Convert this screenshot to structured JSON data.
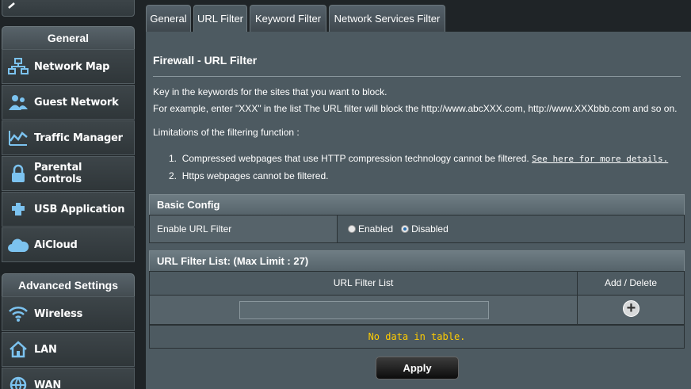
{
  "sidebar": {
    "general_header": "General",
    "general_items": [
      {
        "label": "Network Map",
        "icon": "network-map-icon"
      },
      {
        "label": "Guest Network",
        "icon": "guest-network-icon"
      },
      {
        "label": "Traffic Manager",
        "icon": "traffic-manager-icon"
      },
      {
        "label": "Parental Controls",
        "icon": "parental-controls-icon"
      },
      {
        "label": "USB Application",
        "icon": "usb-application-icon"
      },
      {
        "label": "AiCloud",
        "icon": "aicloud-icon"
      }
    ],
    "advanced_header": "Advanced Settings",
    "advanced_items": [
      {
        "label": "Wireless",
        "icon": "wireless-icon"
      },
      {
        "label": "LAN",
        "icon": "lan-icon"
      },
      {
        "label": "WAN",
        "icon": "wan-icon"
      }
    ]
  },
  "tabs": [
    {
      "label": "General",
      "active": false
    },
    {
      "label": "URL Filter",
      "active": true
    },
    {
      "label": "Keyword Filter",
      "active": false
    },
    {
      "label": "Network Services Filter",
      "active": false
    }
  ],
  "main": {
    "title": "Firewall - URL Filter",
    "desc_line1": "Key in the keywords for the sites that you want to block.",
    "desc_line2": "For example, enter \"XXX\" in the list The URL filter will block the http://www.abcXXX.com, http://www.XXXbbb.com and so on.",
    "limitations_heading": "Limitations of the filtering function :",
    "limitation1_num": "1.",
    "limitation1_text": "Compressed webpages that use HTTP compression technology cannot be filtered.",
    "limitation1_link": "See here for more details.",
    "limitation2_num": "2.",
    "limitation2_text": "Https webpages cannot be filtered."
  },
  "basic_config": {
    "header": "Basic Config",
    "enable_label": "Enable URL Filter",
    "option_enabled": "Enabled",
    "option_disabled": "Disabled",
    "selected": "Disabled"
  },
  "filter_list": {
    "header": "URL Filter List: (Max Limit : 27)",
    "col_list": "URL Filter List",
    "col_action": "Add / Delete",
    "input_value": "",
    "add_symbol": "+",
    "empty_text": "No data in table."
  },
  "apply_label": "Apply",
  "colors": {
    "panel": "#4d5a61",
    "page_bg": "#1f2427",
    "empty_text": "#ffcc00"
  }
}
